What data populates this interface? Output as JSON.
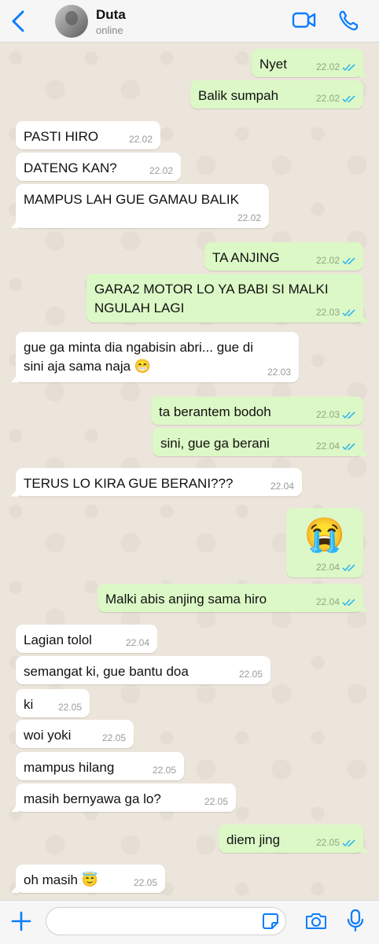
{
  "header": {
    "contact_name": "Duta",
    "status": "online"
  },
  "messages": [
    {
      "dir": "out",
      "text": "Nyet",
      "time": "22.02"
    },
    {
      "dir": "out",
      "text": "Balik sumpah",
      "time": "22.02"
    },
    {
      "dir": "in",
      "text": "PASTI HIRO",
      "time": "22.02"
    },
    {
      "dir": "in",
      "text": "DATENG KAN?",
      "time": "22.02"
    },
    {
      "dir": "in",
      "text": "MAMPUS LAH GUE GAMAU BALIK",
      "time": "22.02"
    },
    {
      "dir": "out",
      "text": "TA ANJING",
      "time": "22.02"
    },
    {
      "dir": "out",
      "text": "GARA2 MOTOR LO YA BABI SI MALKI NGULAH LAGI",
      "time": "22.03"
    },
    {
      "dir": "in",
      "text": "gue ga minta dia ngabisin abri... gue di sini aja sama naja 😁",
      "time": "22.03"
    },
    {
      "dir": "out",
      "text": "ta berantem bodoh",
      "time": "22.03"
    },
    {
      "dir": "out",
      "text": "sini, gue ga berani",
      "time": "22.04"
    },
    {
      "dir": "in",
      "text": "TERUS LO KIRA GUE BERANI???",
      "time": "22.04"
    },
    {
      "dir": "out",
      "text": "😭",
      "time": "22.04"
    },
    {
      "dir": "out",
      "text": "Malki abis anjing sama hiro",
      "time": "22.04"
    },
    {
      "dir": "in",
      "text": "Lagian tolol",
      "time": "22.04"
    },
    {
      "dir": "in",
      "text": "semangat ki, gue bantu doa",
      "time": "22.05"
    },
    {
      "dir": "in",
      "text": "ki",
      "time": "22.05"
    },
    {
      "dir": "in",
      "text": "woi yoki",
      "time": "22.05"
    },
    {
      "dir": "in",
      "text": "mampus hilang",
      "time": "22.05"
    },
    {
      "dir": "in",
      "text": "masih bernyawa ga lo?",
      "time": "22.05"
    },
    {
      "dir": "out",
      "text": "diem jing",
      "time": "22.05"
    },
    {
      "dir": "in",
      "text": "oh masih 😇",
      "time": "22.05"
    }
  ],
  "colors": {
    "accent": "#0a7cff",
    "outgoing_bubble": "#dcf8c6",
    "incoming_bubble": "#ffffff",
    "read_ticks": "#34b7f1"
  },
  "icons": [
    "back-chevron-icon",
    "video-call-icon",
    "phone-icon",
    "plus-icon",
    "sticker-icon",
    "camera-icon",
    "microphone-icon"
  ]
}
